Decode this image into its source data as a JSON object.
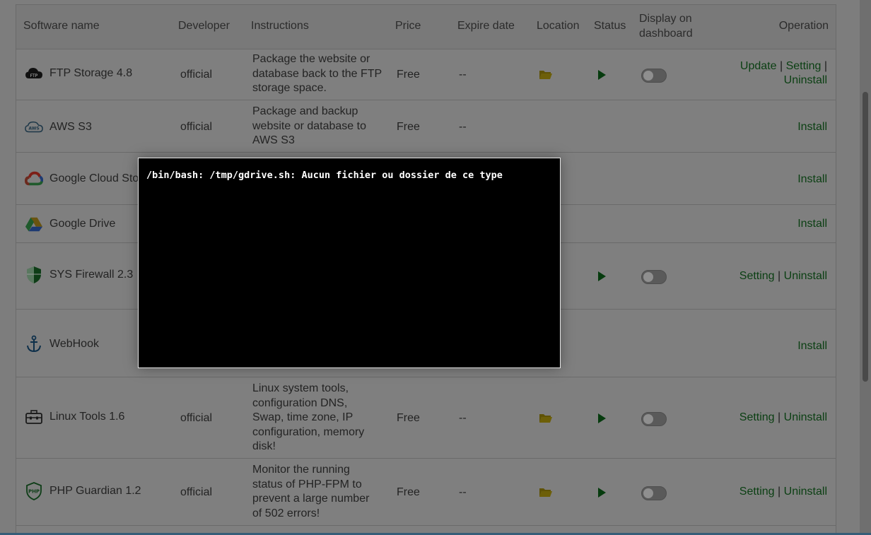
{
  "columns": {
    "software_name": "Software name",
    "developer": "Developer",
    "instructions": "Instructions",
    "price": "Price",
    "expire_date": "Expire date",
    "location": "Location",
    "status": "Status",
    "display_line1": "Display on",
    "display_line2": "dashboard",
    "operation": "Operation"
  },
  "rows": [
    {
      "name": "FTP Storage 4.8",
      "icon": "ftp-icon",
      "developer": "official",
      "instructions": [
        "Package the website or",
        "database back to the FTP",
        "storage space."
      ],
      "price": "Free",
      "expire": "--",
      "ops": [
        "Update",
        "Setting",
        "Uninstall"
      ]
    },
    {
      "name": "AWS S3",
      "icon": "aws-icon",
      "developer": "official",
      "instructions": [
        "Package and backup",
        "website or database to",
        "AWS S3"
      ],
      "price": "Free",
      "expire": "--",
      "ops": [
        "Install"
      ]
    },
    {
      "name": "Google Cloud Sto",
      "icon": "google-cloud-icon",
      "ops": [
        "Install"
      ]
    },
    {
      "name": "Google Drive",
      "icon": "google-drive-icon",
      "ops": [
        "Install"
      ]
    },
    {
      "name": "SYS Firewall 2.3",
      "icon": "shield-icon",
      "ops": [
        "Setting",
        "Uninstall"
      ]
    },
    {
      "name": "WebHook",
      "icon": "anchor-icon",
      "ops": [
        "Install"
      ]
    },
    {
      "name": "Linux Tools 1.6",
      "icon": "toolbox-icon",
      "developer": "official",
      "instructions": [
        "Linux system tools,",
        "configuration DNS,",
        "Swap, time zone, IP",
        "configuration, memory",
        "disk!"
      ],
      "price": "Free",
      "expire": "--",
      "ops": [
        "Setting",
        "Uninstall"
      ]
    },
    {
      "name": "PHP Guardian 1.2",
      "icon": "php-shield-icon",
      "developer": "official",
      "instructions": [
        "Monitor the running",
        "status of PHP-FPM to",
        "prevent a large number",
        "of 502 errors!"
      ],
      "price": "Free",
      "expire": "--",
      "ops": [
        "Setting",
        "Uninstall"
      ]
    }
  ],
  "ops_sep": "|",
  "terminal": {
    "output": "/bin/bash: /tmp/gdrive.sh: Aucun fichier ou dossier de ce type"
  }
}
